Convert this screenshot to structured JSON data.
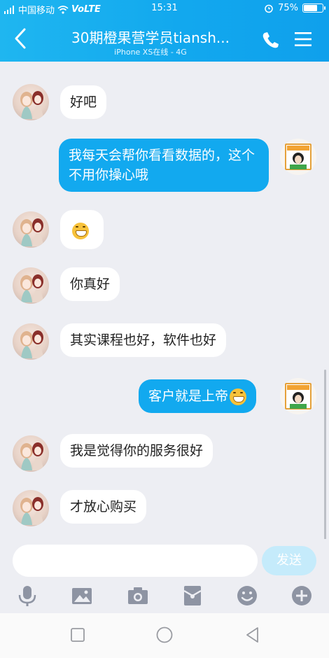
{
  "status_bar": {
    "carrier": "中国移动",
    "network": "VoLTE",
    "time": "15:31",
    "battery": "75%",
    "battery_level": 0.75
  },
  "header": {
    "title": "30期橙果营学员tiansh...",
    "subtitle": "iPhone XS在线 - 4G"
  },
  "messages": [
    {
      "from": "them",
      "text": "好吧"
    },
    {
      "from": "me",
      "text": "我每天会帮你看看数据的，这个不用你操心哦"
    },
    {
      "from": "them",
      "text": "",
      "emoji": "grin-emoji"
    },
    {
      "from": "them",
      "text": "你真好"
    },
    {
      "from": "them",
      "text": "其实课程也好，软件也好"
    },
    {
      "from": "me",
      "text": "客户就是上帝",
      "emoji": "grin-emoji"
    },
    {
      "from": "them",
      "text": "我是觉得你的服务很好"
    },
    {
      "from": "them",
      "text": "才放心购买"
    }
  ],
  "input": {
    "placeholder": "",
    "send_label": "发送"
  },
  "toolbar": {
    "icons": [
      "microphone-icon",
      "image-icon",
      "camera-icon",
      "red-packet-icon",
      "emoji-icon",
      "plus-icon"
    ]
  },
  "colors": {
    "header": "#12a8ee",
    "bubble_out": "#12a9ef",
    "bubble_in": "#ffffff",
    "background": "#edeef3",
    "send_disabled": "#c5ebfb"
  }
}
